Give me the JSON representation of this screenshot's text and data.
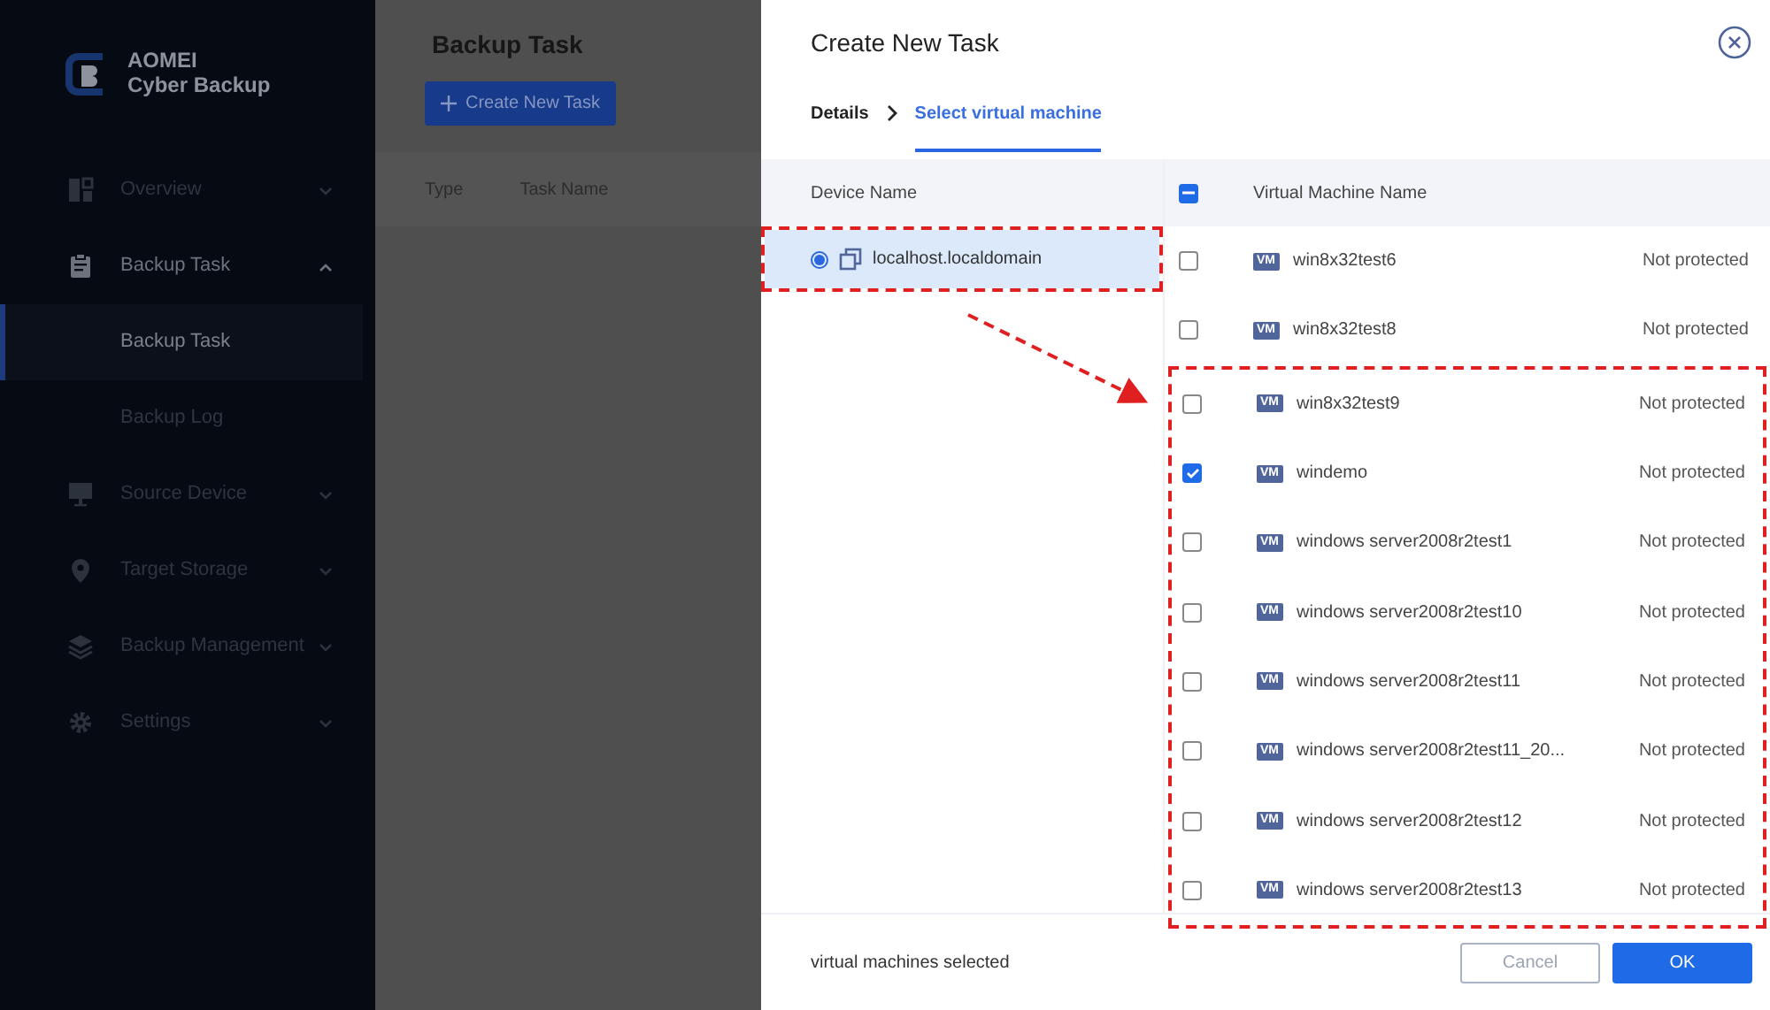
{
  "sidebar": {
    "logo": {
      "line1": "AOMEI",
      "line2": "Cyber Backup"
    },
    "items": [
      {
        "label": "Overview",
        "expanded": false
      },
      {
        "label": "Backup Task",
        "expanded": true,
        "children": [
          {
            "label": "Backup Task",
            "selected": true
          },
          {
            "label": "Backup Log",
            "selected": false
          }
        ]
      },
      {
        "label": "Source Device",
        "expanded": false
      },
      {
        "label": "Target Storage",
        "expanded": false
      },
      {
        "label": "Backup Management",
        "expanded": false
      },
      {
        "label": "Settings",
        "expanded": false
      }
    ]
  },
  "page": {
    "title": "Backup Task",
    "create_button": "Create New Task",
    "columns": [
      "Type",
      "Task Name"
    ]
  },
  "dialog": {
    "title": "Create New Task",
    "steps": [
      {
        "label": "Details",
        "selected": false
      },
      {
        "label": "Select virtual machine",
        "selected": true
      }
    ],
    "device_column": "Device Name",
    "devices": [
      {
        "name": "localhost.localdomain",
        "selected": true,
        "highlighted": true
      }
    ],
    "vm_column": "Virtual Machine Name",
    "select_all_indeterminate": true,
    "vms": [
      {
        "badge": "VM",
        "name": "win8x32test6",
        "status": "Not protected",
        "checked": false,
        "highlighted": false
      },
      {
        "badge": "VM",
        "name": "win8x32test8",
        "status": "Not protected",
        "checked": false,
        "highlighted": false
      },
      {
        "badge": "VM",
        "name": "win8x32test9",
        "status": "Not protected",
        "checked": false,
        "highlighted": true
      },
      {
        "badge": "VM",
        "name": "windemo",
        "status": "Not protected",
        "checked": true,
        "highlighted": true
      },
      {
        "badge": "VM",
        "name": "windows server2008r2test1",
        "status": "Not protected",
        "checked": false,
        "highlighted": true
      },
      {
        "badge": "VM",
        "name": "windows server2008r2test10",
        "status": "Not protected",
        "checked": false,
        "highlighted": true
      },
      {
        "badge": "VM",
        "name": "windows server2008r2test11",
        "status": "Not protected",
        "checked": false,
        "highlighted": true
      },
      {
        "badge": "VM",
        "name": "windows server2008r2test11_20...",
        "status": "Not protected",
        "checked": false,
        "highlighted": true
      },
      {
        "badge": "VM",
        "name": "windows server2008r2test12",
        "status": "Not protected",
        "checked": false,
        "highlighted": true
      },
      {
        "badge": "VM",
        "name": "windows server2008r2test13",
        "status": "Not protected",
        "checked": false,
        "highlighted": true
      }
    ],
    "footer_text": "virtual machines selected",
    "buttons": [
      {
        "label": "Cancel",
        "kind": "secondary"
      },
      {
        "label": "OK",
        "kind": "primary"
      }
    ]
  }
}
